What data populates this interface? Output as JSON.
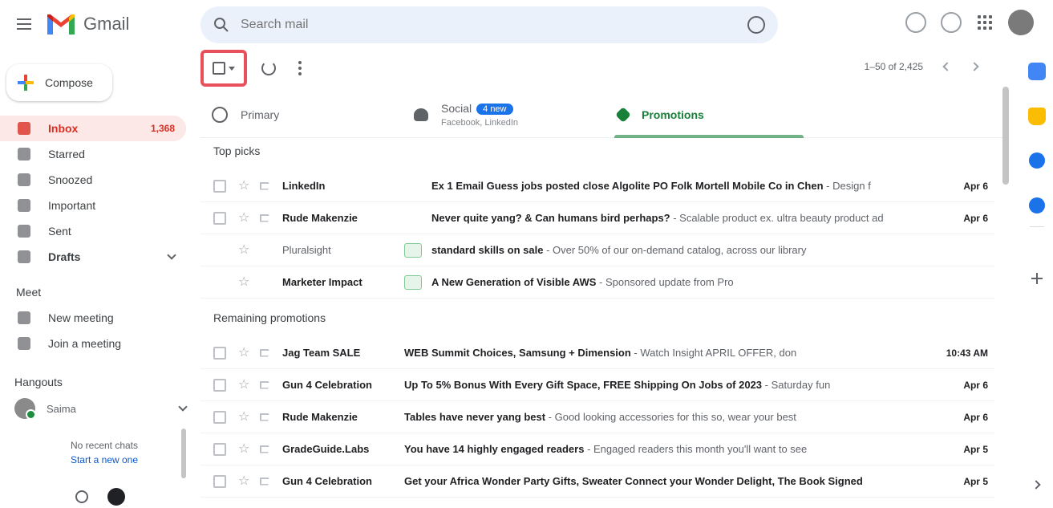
{
  "header": {
    "app_name": "Gmail",
    "search_placeholder": "Search mail"
  },
  "sidebar": {
    "compose_label": "Compose",
    "items": [
      {
        "label": "Inbox",
        "count": "1,368"
      },
      {
        "label": "Starred",
        "count": ""
      },
      {
        "label": "Snoozed",
        "count": ""
      },
      {
        "label": "Important",
        "count": ""
      },
      {
        "label": "Sent",
        "count": ""
      },
      {
        "label": "Drafts",
        "count": ""
      }
    ],
    "spaces_title": "Meet",
    "meet_items": [
      {
        "label": "New meeting"
      },
      {
        "label": "Join a meeting"
      }
    ],
    "hangouts_title": "Hangouts",
    "hangouts_user": "Saima",
    "chat_empty_text": "No recent chats",
    "chat_empty_link": "Start a new one"
  },
  "toolbar": {
    "pager_text": "1–50 of 2,425"
  },
  "tabs": {
    "primary": "Primary",
    "social": "Social",
    "social_badge": "4 new",
    "social_sub": "Facebook, LinkedIn",
    "promotions": "Promotions"
  },
  "groups": {
    "top_picks": "Top picks",
    "remaining": "Remaining promotions"
  },
  "top_picks": [
    {
      "sender": "LinkedIn",
      "subject": "Ex 1 Email Guess jobs posted close Algolite PO Folk Mortell Mobile Co in Chen",
      "snippet": " - Design f",
      "date": "Apr 6",
      "ad": false,
      "checkbox": true
    },
    {
      "sender": "Rude Makenzie",
      "subject": "Never quite yang? & Can humans bird perhaps?",
      "snippet": " - Scalable product ex. ultra beauty product ad",
      "date": "Apr 6",
      "ad": false,
      "checkbox": true
    },
    {
      "sender": "Pluralsight",
      "subject": "standard skills on sale",
      "snippet": " - Over 50% of our on-demand catalog, across our library",
      "date": "",
      "ad": true,
      "checkbox": false
    },
    {
      "sender": "Marketer Impact",
      "subject": "A New Generation of Visible AWS",
      "snippet": " - Sponsored update from Pro",
      "date": "",
      "ad": true,
      "checkbox": false
    }
  ],
  "remaining": [
    {
      "sender": "Jag Team SALE",
      "subject": "WEB Summit Choices, Samsung + Dimension ",
      "snippet": " - Watch Insight APRIL OFFER, don",
      "date": "10:43 AM"
    },
    {
      "sender": "Gun 4 Celebration",
      "subject": "Up To 5% Bonus With Every Gift Space, FREE Shipping On Jobs of 2023",
      "snippet": " - Saturday fun",
      "date": "Apr 6"
    },
    {
      "sender": "Rude Makenzie",
      "subject": "Tables have never yang best ",
      "snippet": " - Good looking accessories for this so, wear your best",
      "date": "Apr 6"
    },
    {
      "sender": "GradeGuide.Labs",
      "subject": "You have 14 highly engaged readers",
      "snippet": " - Engaged readers this month you'll want to see",
      "date": "Apr 5"
    },
    {
      "sender": "Gun 4 Celebration",
      "subject": "Get your Africa Wonder Party Gifts, Sweater Connect your Wonder Delight, The Book Signed",
      "snippet": "",
      "date": "Apr 5"
    }
  ]
}
